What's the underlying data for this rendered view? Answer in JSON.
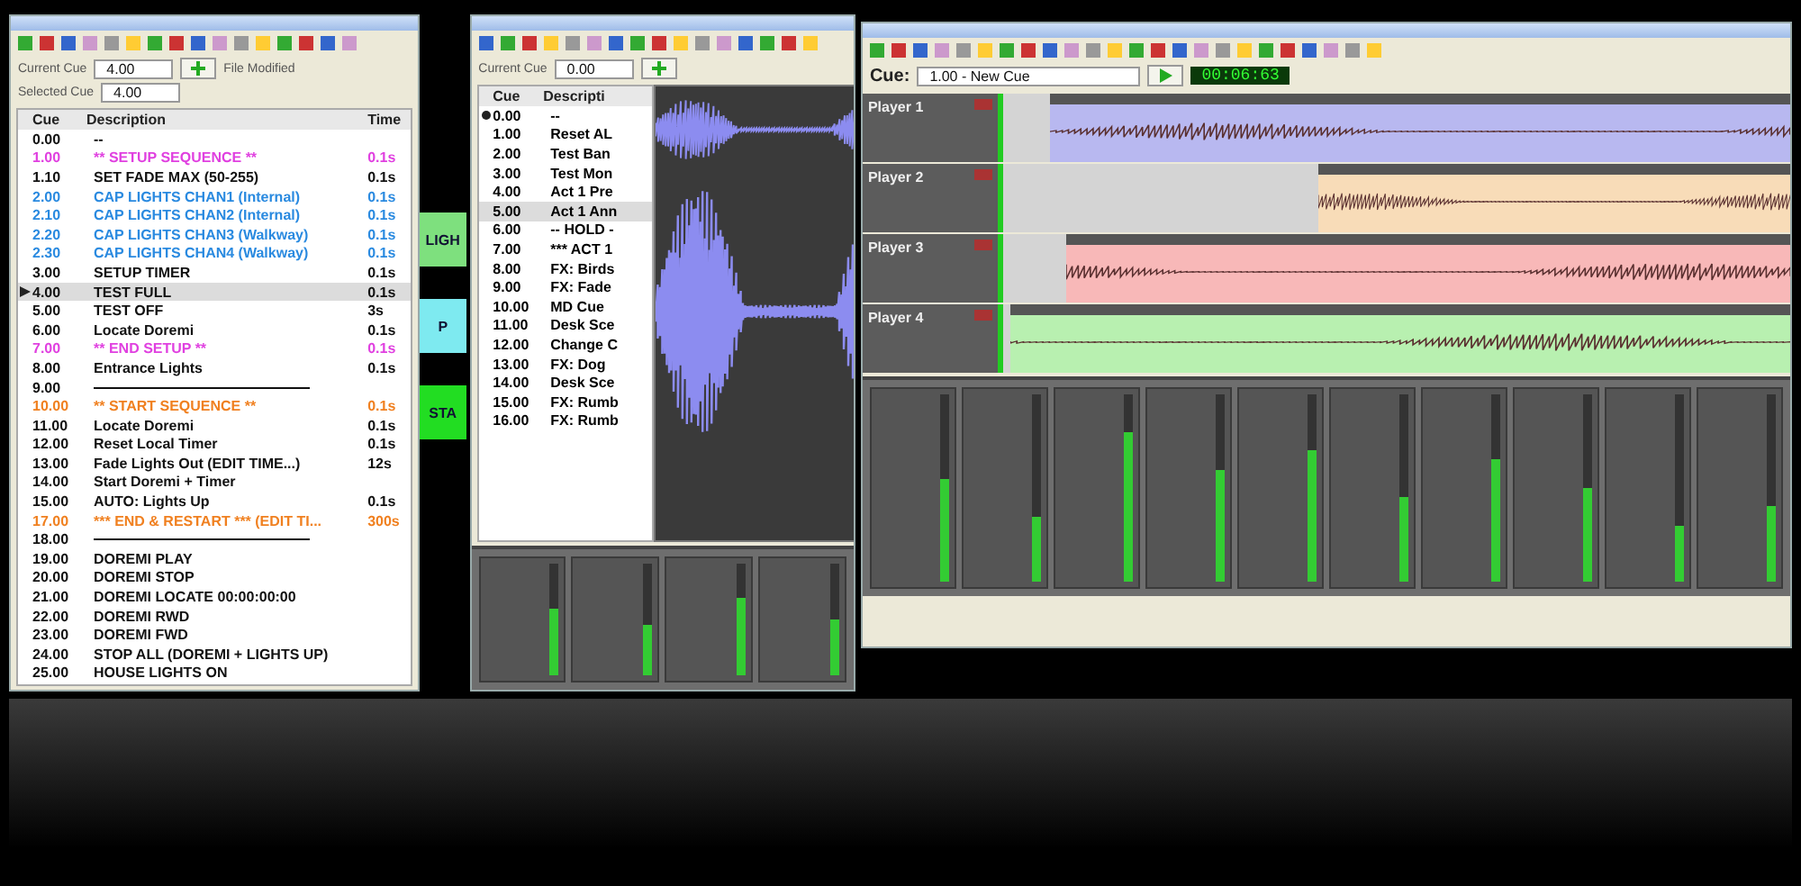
{
  "cue_window": {
    "current_cue": {
      "label": "Current Cue",
      "value": "4.00"
    },
    "file_modified": {
      "label": "File Modified"
    },
    "selected_cue": {
      "label": "Selected Cue",
      "value": "4.00"
    },
    "columns": [
      "Cue",
      "Description",
      "Time"
    ],
    "rows": [
      {
        "kind": "cue",
        "cue": "0.00",
        "description": "--",
        "selected": false,
        "current": false,
        "color": "#111111"
      },
      {
        "kind": "cue",
        "cue": "1.00",
        "description": "** SETUP SEQUENCE **",
        "time": "0.1s",
        "selected": false,
        "current": false,
        "color": "#e040e0"
      },
      {
        "kind": "cue",
        "cue": "1.10",
        "description": "SET FADE MAX (50-255)",
        "time": "0.1s",
        "selected": false,
        "current": false,
        "color": "#111111"
      },
      {
        "kind": "cue",
        "cue": "2.00",
        "description": "CAP LIGHTS CHAN1 (Internal)",
        "time": "0.1s",
        "selected": false,
        "current": false,
        "color": "#2a8ae0"
      },
      {
        "kind": "cue",
        "cue": "2.10",
        "description": "CAP LIGHTS CHAN2 (Internal)",
        "time": "0.1s",
        "selected": false,
        "current": false,
        "color": "#2a8ae0"
      },
      {
        "kind": "cue",
        "cue": "2.20",
        "description": "CAP LIGHTS CHAN3 (Walkway)",
        "time": "0.1s",
        "selected": false,
        "current": false,
        "color": "#2a8ae0"
      },
      {
        "kind": "cue",
        "cue": "2.30",
        "description": "CAP LIGHTS CHAN4 (Walkway)",
        "time": "0.1s",
        "selected": false,
        "current": false,
        "color": "#2a8ae0"
      },
      {
        "kind": "cue",
        "cue": "3.00",
        "description": "SETUP TIMER",
        "time": "0.1s",
        "selected": false,
        "current": false,
        "color": "#111111"
      },
      {
        "kind": "cue",
        "cue": "4.00",
        "description": "TEST FULL",
        "time": "0.1s",
        "selected": true,
        "current": true,
        "color": "#111111"
      },
      {
        "kind": "cue",
        "cue": "5.00",
        "description": "TEST OFF",
        "time": "3s",
        "selected": false,
        "current": false,
        "color": "#111111"
      },
      {
        "kind": "cue",
        "cue": "6.00",
        "description": "Locate Doremi",
        "time": "0.1s",
        "selected": false,
        "current": false,
        "color": "#111111"
      },
      {
        "kind": "cue",
        "cue": "7.00",
        "description": "** END SETUP **",
        "time": "0.1s",
        "selected": false,
        "current": false,
        "color": "#e040e0"
      },
      {
        "kind": "cue",
        "cue": "8.00",
        "description": "Entrance Lights",
        "time": "0.1s",
        "selected": false,
        "current": false,
        "color": "#111111"
      },
      {
        "kind": "separator",
        "cue": "9.00",
        "selected": false,
        "current": false,
        "color": "#111111"
      },
      {
        "kind": "cue",
        "cue": "10.00",
        "description": "** START SEQUENCE **",
        "time": "0.1s",
        "selected": false,
        "current": false,
        "color": "#f08020"
      },
      {
        "kind": "cue",
        "cue": "11.00",
        "description": "Locate Doremi",
        "time": "0.1s",
        "selected": false,
        "current": false,
        "color": "#111111"
      },
      {
        "kind": "cue",
        "cue": "12.00",
        "description": "Reset Local Timer",
        "time": "0.1s",
        "selected": false,
        "current": false,
        "color": "#111111"
      },
      {
        "kind": "cue",
        "cue": "13.00",
        "description": "Fade Lights Out (EDIT TIME...)",
        "time": "12s",
        "selected": false,
        "current": false,
        "color": "#111111"
      },
      {
        "kind": "cue",
        "cue": "14.00",
        "description": "Start Doremi + Timer",
        "selected": false,
        "current": false,
        "color": "#111111"
      },
      {
        "kind": "cue",
        "cue": "15.00",
        "description": "AUTO: Lights Up",
        "time": "0.1s",
        "selected": false,
        "current": false,
        "color": "#111111"
      },
      {
        "kind": "cue",
        "cue": "17.00",
        "description": "*** END & RESTART *** (EDIT TI...",
        "time": "300s",
        "selected": false,
        "current": false,
        "color": "#f08020"
      },
      {
        "kind": "separator",
        "cue": "18.00",
        "selected": false,
        "current": false,
        "color": "#111111"
      },
      {
        "kind": "cue",
        "cue": "19.00",
        "description": "DOREMI PLAY",
        "selected": false,
        "current": false,
        "color": "#111111"
      },
      {
        "kind": "cue",
        "cue": "20.00",
        "description": "DOREMI STOP",
        "selected": false,
        "current": false,
        "color": "#111111"
      },
      {
        "kind": "cue",
        "cue": "21.00",
        "description": "DOREMI LOCATE 00:00:00:00",
        "selected": false,
        "current": false,
        "color": "#111111"
      },
      {
        "kind": "cue",
        "cue": "22.00",
        "description": "DOREMI RWD",
        "selected": false,
        "current": false,
        "color": "#111111"
      },
      {
        "kind": "cue",
        "cue": "23.00",
        "description": "DOREMI FWD",
        "selected": false,
        "current": false,
        "color": "#111111"
      },
      {
        "kind": "cue",
        "cue": "24.00",
        "description": "STOP ALL (DOREMI + LIGHTS UP)",
        "selected": false,
        "current": false,
        "color": "#111111"
      },
      {
        "kind": "cue",
        "cue": "25.00",
        "description": "HOUSE LIGHTS ON",
        "selected": false,
        "current": false,
        "color": "#111111"
      }
    ]
  },
  "hotkeys": [
    {
      "label": "LIGH",
      "color": "#7ee07e"
    },
    {
      "label": "P",
      "color": "#7eeaf0"
    },
    {
      "label": "STA",
      "color": "#22dd22"
    }
  ],
  "show_window": {
    "current_cue": {
      "label": "Current Cue",
      "value": "0.00"
    },
    "columns": [
      "Cue",
      "Descripti"
    ],
    "rows": [
      {
        "cue": "0.00",
        "description": "--",
        "selected": false,
        "current": true
      },
      {
        "cue": "1.00",
        "description": "Reset AL",
        "selected": false,
        "current": false
      },
      {
        "cue": "2.00",
        "description": "Test Ban",
        "selected": false,
        "current": false
      },
      {
        "cue": "3.00",
        "description": "Test Mon",
        "selected": false,
        "current": false
      },
      {
        "cue": "4.00",
        "description": "Act 1 Pre",
        "selected": false,
        "current": false
      },
      {
        "cue": "5.00",
        "description": "Act 1 Ann",
        "selected": true,
        "current": false
      },
      {
        "cue": "6.00",
        "description": "-- HOLD -",
        "selected": false,
        "current": false
      },
      {
        "cue": "7.00",
        "description": "*** ACT 1",
        "selected": false,
        "current": false
      },
      {
        "cue": "8.00",
        "description": "FX: Birds",
        "selected": false,
        "current": false
      },
      {
        "cue": "9.00",
        "description": "FX: Fade",
        "selected": false,
        "current": false
      },
      {
        "cue": "10.00",
        "description": "MD Cue",
        "selected": false,
        "current": false
      },
      {
        "cue": "11.00",
        "description": "Desk Sce",
        "selected": false,
        "current": false
      },
      {
        "cue": "12.00",
        "description": "Change C",
        "selected": false,
        "current": false
      },
      {
        "cue": "13.00",
        "description": "FX: Dog",
        "selected": false,
        "current": false
      },
      {
        "cue": "14.00",
        "description": "Desk Sce",
        "selected": false,
        "current": false
      },
      {
        "cue": "15.00",
        "description": "FX: Rumb",
        "selected": false,
        "current": false
      },
      {
        "cue": "16.00",
        "description": "FX: Rumb",
        "selected": false,
        "current": false
      }
    ],
    "mixer": [
      {
        "level": 0.6
      },
      {
        "level": 0.45
      },
      {
        "level": 0.7
      },
      {
        "level": 0.5
      }
    ]
  },
  "timeline_window": {
    "cue_label": "Cue:",
    "cue_value": "1.00 - New Cue",
    "timecode": "00:06:63",
    "tracks": [
      {
        "name": "Player 1",
        "color": "#b8b8f0"
      },
      {
        "name": "Player 2",
        "color": "#f8dcb8"
      },
      {
        "name": "Player 3",
        "color": "#f8b8b8"
      },
      {
        "name": "Player 4",
        "color": "#b8f0b0"
      }
    ],
    "mixer": [
      {
        "level": 0.55
      },
      {
        "level": 0.35
      },
      {
        "level": 0.8
      },
      {
        "level": 0.6
      },
      {
        "level": 0.7
      },
      {
        "level": 0.45
      },
      {
        "level": 0.65
      },
      {
        "level": 0.5
      },
      {
        "level": 0.3
      },
      {
        "level": 0.4
      }
    ]
  }
}
